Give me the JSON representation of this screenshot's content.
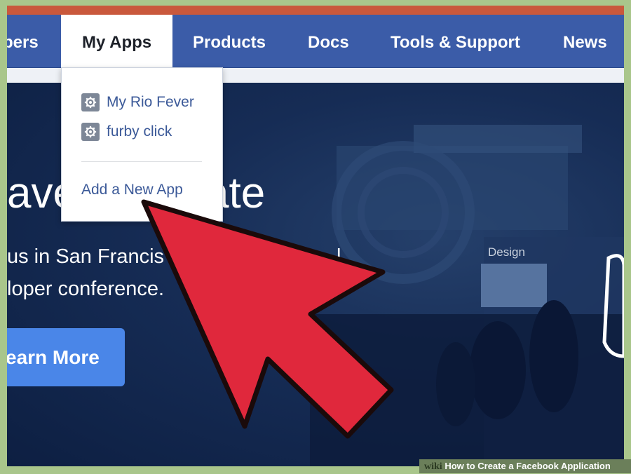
{
  "navbar": {
    "items": [
      {
        "label": "pers"
      },
      {
        "label": "My Apps"
      },
      {
        "label": "Products"
      },
      {
        "label": "Docs"
      },
      {
        "label": "Tools & Support"
      },
      {
        "label": "News"
      }
    ]
  },
  "dropdown": {
    "apps": [
      {
        "label": "My Rio Fever",
        "icon": "gear-icon"
      },
      {
        "label": "furby click",
        "icon": "gear-icon"
      }
    ],
    "add_label": "Add a New App"
  },
  "hero": {
    "title_left": "ave",
    "title_right": "ate",
    "subtitle_line1_left": "us in San Francis",
    "subtitle_line1_right": "l",
    "subtitle_line2": "loper conference.",
    "button_label": "earn More",
    "booth_label": "Design"
  },
  "footer": {
    "brand": "wiki",
    "caption": "How to Create a Facebook Application"
  },
  "colors": {
    "nav_bg": "#3b5ca8",
    "accent_button": "#4a86e8",
    "arrow": "#e0283c",
    "link": "#3b5998"
  }
}
